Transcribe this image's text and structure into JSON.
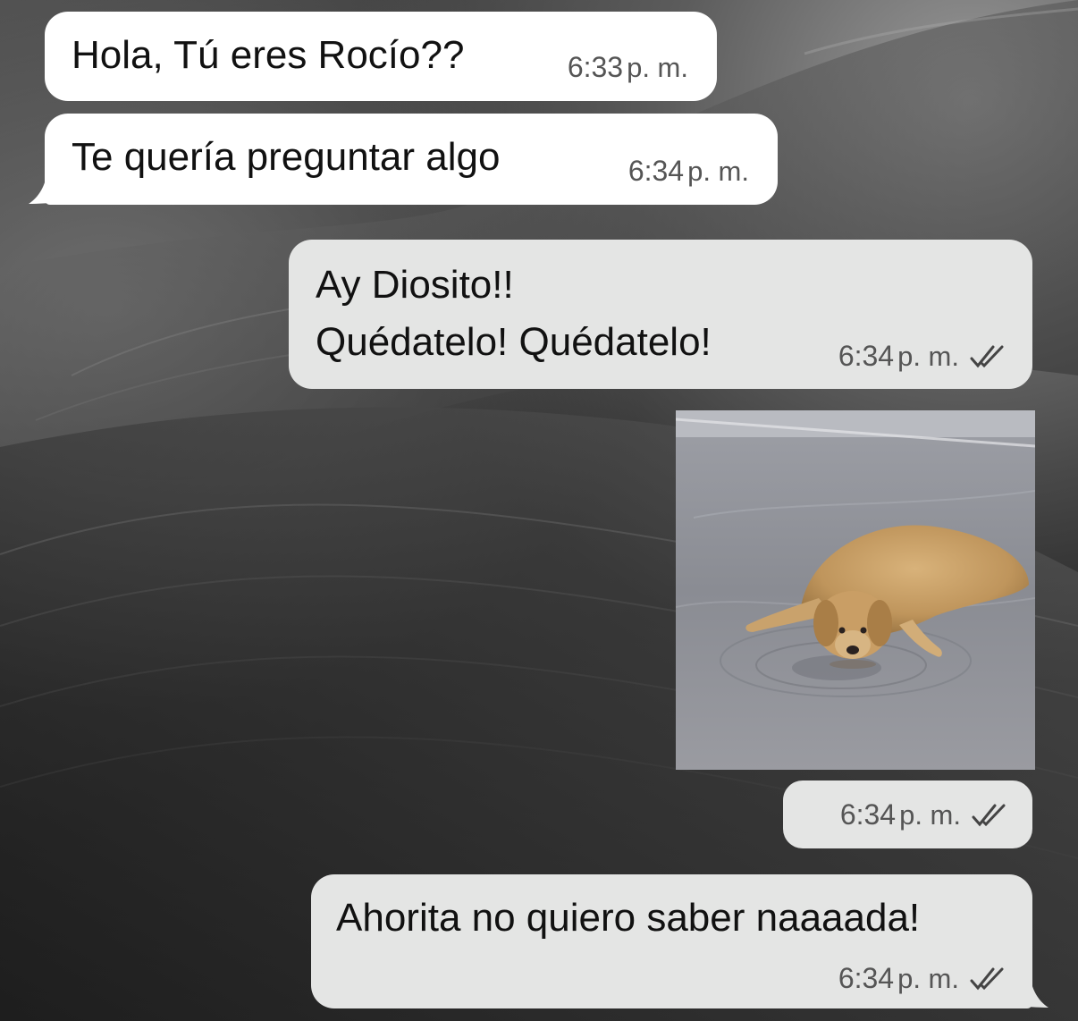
{
  "chat": {
    "messages": [
      {
        "direction": "incoming",
        "text": "Hola, Tú eres Rocío??",
        "time": "6:33",
        "ampm": "p. m."
      },
      {
        "direction": "incoming",
        "text": "Te quería preguntar algo",
        "time": "6:34",
        "ampm": "p. m."
      },
      {
        "direction": "outgoing",
        "lines": [
          "Ay Diosito!!",
          "Quédatelo! Quédatelo!"
        ],
        "time": "6:34",
        "ampm": "p. m.",
        "status": "double-check-icon"
      },
      {
        "direction": "outgoing",
        "type": "image",
        "image": "golden-retriever-lying-in-puddle",
        "time": "6:34",
        "ampm": "p. m.",
        "status": "double-check-icon"
      },
      {
        "direction": "outgoing",
        "text": "Ahorita no quiero saber naaaada!",
        "time": "6:34",
        "ampm": "p. m.",
        "status": "double-check-icon"
      }
    ]
  },
  "colors": {
    "incoming_bubble": "#ffffff",
    "outgoing_bubble": "#e4e5e4",
    "text": "#111111",
    "meta": "#555555",
    "wallpaper": "#2a2a2a"
  }
}
